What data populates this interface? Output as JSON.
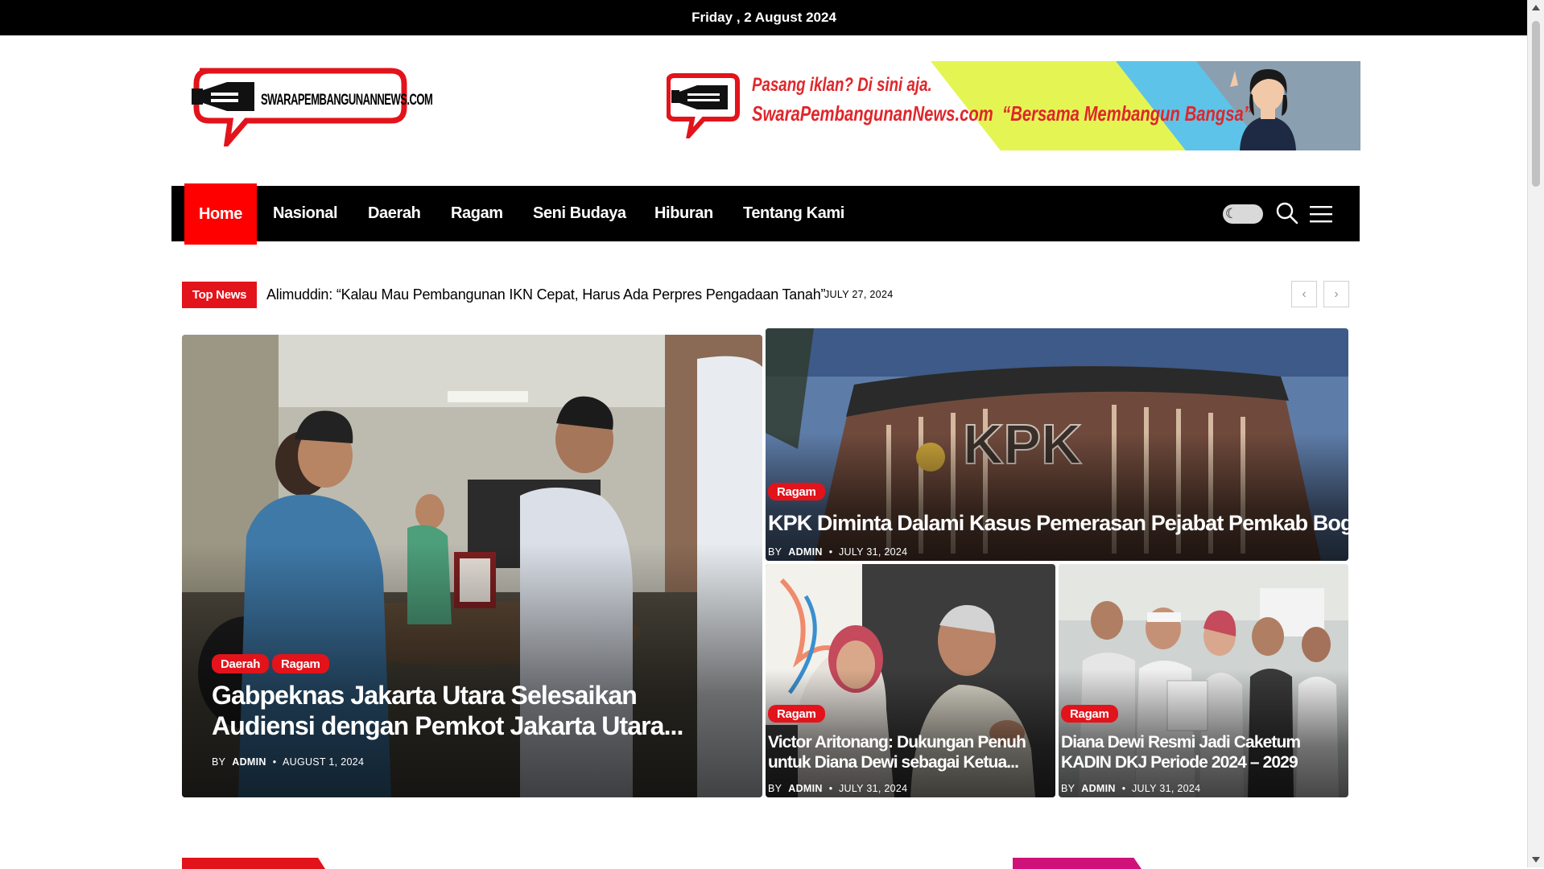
{
  "topbar": {
    "date": "Friday , 2 August 2024"
  },
  "logo": {
    "text": "SWARAPEMBANGUNANNEWS.COM"
  },
  "banner": {
    "line1": "Pasang iklan? Di sini aja.",
    "line2": "SwaraPembangunanNews.com",
    "tagline": "“Bersama Membangun Bangsa”"
  },
  "nav": {
    "items": [
      {
        "label": "Home",
        "active": true
      },
      {
        "label": "Nasional"
      },
      {
        "label": "Daerah"
      },
      {
        "label": "Ragam"
      },
      {
        "label": "Seni Budaya"
      },
      {
        "label": "Hiburan"
      },
      {
        "label": "Tentang Kami"
      }
    ],
    "icons": [
      "dark-mode-toggle",
      "search-icon",
      "menu-icon"
    ]
  },
  "ticker": {
    "label": "Top News",
    "title": "Alimuddin: “Kalau Mau Pembangunan IKN Cepat, Harus Ada Perpres Pengadaan Tanah”",
    "date": "JULY 27, 2024"
  },
  "featured": {
    "main": {
      "tags": [
        "Daerah",
        "Ragam"
      ],
      "title": "Gabpeknas Jakarta Utara Selesaikan Audiensi dengan Pemkot Jakarta Utara...",
      "by": "BY",
      "author": "ADMIN",
      "date": "AUGUST 1, 2024"
    },
    "top_right": {
      "tag": "Ragam",
      "title": "KPK Diminta Dalami Kasus Pemerasan Pejabat Pemkab Bogor",
      "by": "BY",
      "author": "ADMIN",
      "date": "JULY 31, 2024"
    },
    "bottom_left": {
      "tag": "Ragam",
      "title": "Victor Aritonang: Dukungan Penuh untuk Diana Dewi sebagai Ketua...",
      "by": "BY",
      "author": "ADMIN",
      "date": "JULY 31, 2024"
    },
    "bottom_right": {
      "tag": "Ragam",
      "title": "Diana Dewi Resmi Jadi Caketum KADIN DKJ Periode 2024 – 2029",
      "by": "BY",
      "author": "ADMIN",
      "date": "JULY 31, 2024"
    }
  },
  "colors": {
    "accent": "#e3131b",
    "nav_bg": "#000000",
    "active_nav": "#ff0000"
  }
}
